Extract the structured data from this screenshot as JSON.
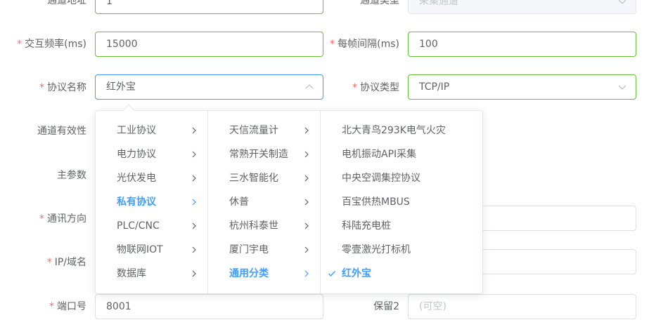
{
  "form": {
    "row0": {
      "label_left": "通道地址",
      "value_left": "1",
      "label_right": "通道类型",
      "value_right": "采集通道"
    },
    "interaction_freq": {
      "label": "交互频率(ms)",
      "value": "15000"
    },
    "frame_interval": {
      "label": "每帧间隔(ms)",
      "value": "100"
    },
    "protocol_name": {
      "label": "协议名称",
      "value": "红外宝"
    },
    "protocol_type": {
      "label": "协议类型",
      "value": "TCP/IP"
    },
    "validity": {
      "label": "通道有效性"
    },
    "main_params": {
      "label": "主参数"
    },
    "comm_direction": {
      "label": "通讯方向"
    },
    "ip_domain": {
      "label": "IP/域名"
    },
    "port": {
      "label": "端口号",
      "value": "8001"
    },
    "reserved2": {
      "label": "保留2",
      "placeholder": "(可空)"
    }
  },
  "cascader": {
    "level1": [
      "工业协议",
      "电力协议",
      "光伏发电",
      "私有协议",
      "PLC/CNC",
      "物联网IOT",
      "数据库"
    ],
    "level1_active": "私有协议",
    "level2": [
      "天信流量计",
      "常熟开关制造",
      "三水智能化",
      "休普",
      "杭州科泰世",
      "厦门宇电",
      "通用分类"
    ],
    "level2_active": "通用分类",
    "level3": [
      "北大青鸟293K电气火灾",
      "电机振动API采集",
      "中央空调集控协议",
      "百宝供热MBUS",
      "科陆充电桩",
      "零壹激光打标机",
      "红外宝"
    ],
    "level3_selected": "红外宝"
  },
  "colors": {
    "required": "#f56c6c",
    "success_border": "#67c23a",
    "focus_border": "#409eff",
    "active_text": "#409eff"
  },
  "icons": {
    "chevron_up": "chevron-up-icon",
    "chevron_down": "chevron-down-icon",
    "chevron_right": "chevron-right-icon",
    "check": "check-icon"
  }
}
